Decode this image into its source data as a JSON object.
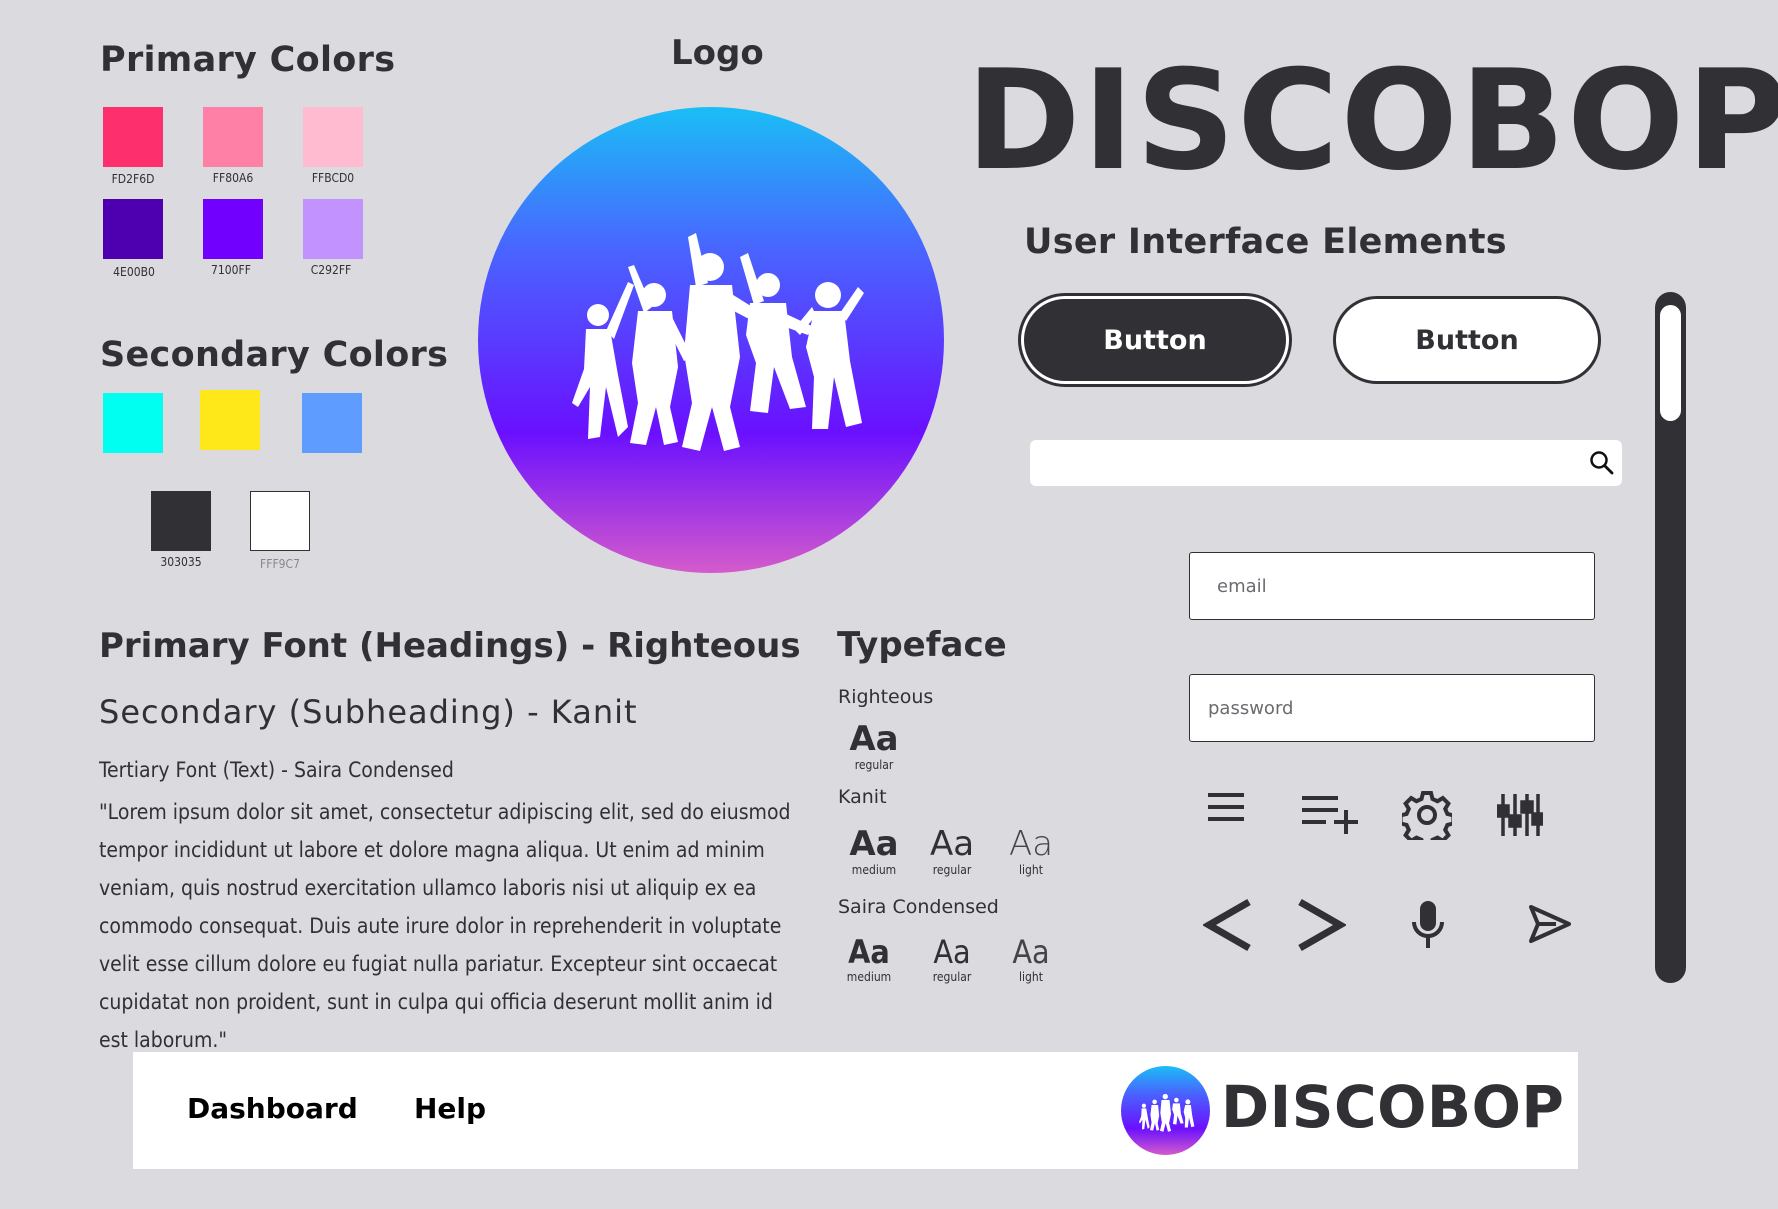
{
  "colors": {
    "heading": "Primary Colors",
    "primary": [
      {
        "hex_label": "FD2F6D",
        "color": "#FD2F6D"
      },
      {
        "hex_label": "FF80A6",
        "color": "#FF80A6"
      },
      {
        "hex_label": "FFBCD0",
        "color": "#FFBCD0"
      },
      {
        "hex_label": "4E00B0",
        "color": "#4E00B0"
      },
      {
        "hex_label": "7100FF",
        "color": "#7100FF"
      },
      {
        "hex_label": "C292FF",
        "color": "#C292FF"
      }
    ],
    "secondary_heading": "Secondary Colors",
    "secondary": [
      "#00FFF0",
      "#FFE81A",
      "#5F9CFF"
    ],
    "neutrals": [
      {
        "hex_label": "303035",
        "color": "#303035"
      },
      {
        "hex_label": "FFF9C7",
        "color": "#FFFFFF"
      }
    ]
  },
  "logo": {
    "heading": "Logo"
  },
  "brand": {
    "name": "DISCOBOP"
  },
  "ui": {
    "heading": "User Interface Elements",
    "button_primary": "Button",
    "button_secondary": "Button",
    "search_placeholder": "",
    "email_placeholder": "email",
    "password_placeholder": "password",
    "icons": [
      "menu-icon",
      "playlist-add-icon",
      "gear-icon",
      "equalizer-icon",
      "chevron-left-icon",
      "chevron-right-icon",
      "microphone-icon",
      "send-icon",
      "search-icon"
    ]
  },
  "fonts": {
    "primary": "Primary Font (Headings) - Righteous",
    "secondary": "Secondary (Subheading) - Kanit",
    "tertiary": "Tertiary Font (Text) - Saira Condensed",
    "sample": "\"Lorem ipsum dolor sit amet, consectetur adipiscing elit, sed do eiusmod tempor incididunt ut labore et dolore magna aliqua. Ut enim ad minim veniam, quis nostrud exercitation ullamco laboris nisi ut aliquip ex ea commodo consequat. Duis aute irure dolor in reprehenderit in voluptate velit esse cillum dolore eu fugiat nulla pariatur. Excepteur sint occaecat cupidatat non proident, sunt in culpa qui officia deserunt mollit anim id est laborum.\""
  },
  "typeface": {
    "heading": "Typeface",
    "families": [
      {
        "name": "Righteous",
        "samples": [
          {
            "glyph": "Aa",
            "weight": "regular"
          }
        ]
      },
      {
        "name": "Kanit",
        "samples": [
          {
            "glyph": "Aa",
            "weight": "medium"
          },
          {
            "glyph": "Aa",
            "weight": "regular"
          },
          {
            "glyph": "Aa",
            "weight": "light"
          }
        ]
      },
      {
        "name": "Saira Condensed",
        "samples": [
          {
            "glyph": "Aa",
            "weight": "medium"
          },
          {
            "glyph": "Aa",
            "weight": "regular"
          },
          {
            "glyph": "Aa",
            "weight": "light"
          }
        ]
      }
    ]
  },
  "footer": {
    "nav": [
      "Dashboard",
      "Help"
    ],
    "brand": "DISCOBOP"
  }
}
